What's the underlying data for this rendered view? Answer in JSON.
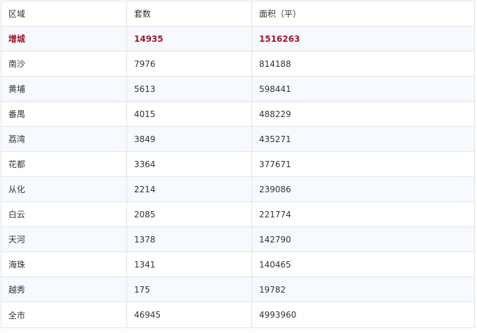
{
  "headers": [
    "区域",
    "套数",
    "面积（平）"
  ],
  "rows": [
    {
      "district": "增城",
      "units": "14935",
      "area": "1516263",
      "highlight": true
    },
    {
      "district": "南沙",
      "units": "7976",
      "area": "814188"
    },
    {
      "district": "黄埔",
      "units": "5613",
      "area": "598441"
    },
    {
      "district": "番禺",
      "units": "4015",
      "area": "488229"
    },
    {
      "district": "荔湾",
      "units": "3849",
      "area": "435271"
    },
    {
      "district": "花都",
      "units": "3364",
      "area": "377671"
    },
    {
      "district": "从化",
      "units": "2214",
      "area": "239086"
    },
    {
      "district": "白云",
      "units": "2085",
      "area": "221774"
    },
    {
      "district": "天河",
      "units": "1378",
      "area": "142790"
    },
    {
      "district": "海珠",
      "units": "1341",
      "area": "140465"
    },
    {
      "district": "越秀",
      "units": "175",
      "area": "19782"
    },
    {
      "district": "全市",
      "units": "46945",
      "area": "4993960"
    }
  ],
  "colors": {
    "highlight_text": "#a3162c",
    "alt_row": "#f6f9fd",
    "border": "#e3e3e3"
  }
}
